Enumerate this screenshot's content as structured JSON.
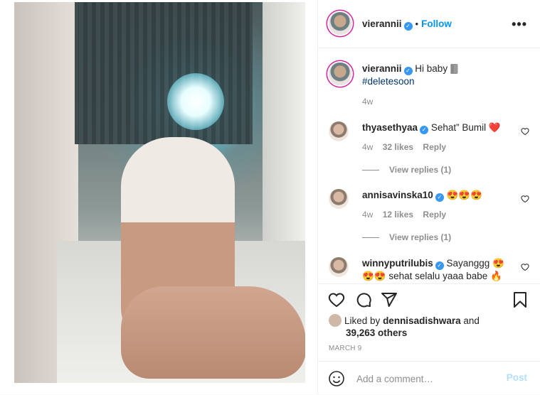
{
  "post": {
    "author": "vierannii",
    "follow_label": "Follow",
    "dot": "•",
    "more_label": "•••",
    "caption_user": "vierannii",
    "caption_text": "Hi baby 🀫",
    "caption_hashtag": "#deletesoon",
    "caption_time": "4w"
  },
  "comments": [
    {
      "user": "thyasethyaa",
      "text": "Sehat” Bumil ❤️",
      "time": "4w",
      "likes": "32 likes",
      "reply": "Reply",
      "view_replies": "View replies (1)"
    },
    {
      "user": "annisavinska10",
      "text": "😍😍😍",
      "time": "4w",
      "likes": "12 likes",
      "reply": "Reply",
      "view_replies": "View replies (1)"
    },
    {
      "user": "winnyputrilubis",
      "text": "Sayanggg 😍",
      "text2": "😍😍 sehat selalu yaaa babe 🔥"
    }
  ],
  "likes": {
    "prefix": "Liked by",
    "user": "dennisadishwara",
    "and": "and",
    "count": "39,263 others"
  },
  "date": "MARCH 9",
  "add_comment": {
    "placeholder": "Add a comment…",
    "post_label": "Post"
  },
  "colors": {
    "link_blue": "#0095f6",
    "verified_blue": "#3897f0",
    "muted": "#8e8e8e",
    "post_disabled": "#b2dffc"
  },
  "icons": [
    "heart-icon",
    "comment-icon",
    "share-icon",
    "bookmark-icon",
    "emoji-icon",
    "verified-badge",
    "more-options-icon"
  ]
}
